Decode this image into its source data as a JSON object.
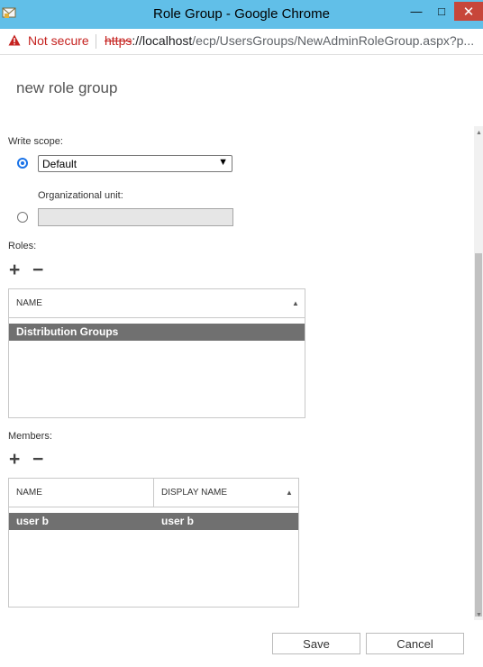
{
  "window": {
    "title": "Role Group - Google Chrome",
    "min_glyph": "—",
    "max_glyph": "□",
    "close_glyph": "✕"
  },
  "addressbar": {
    "not_secure": "Not secure",
    "scheme": "https",
    "host": "://localhost",
    "path": "/ecp/UsersGroups/NewAdminRoleGroup.aspx?p..."
  },
  "page": {
    "title": "new role group"
  },
  "write_scope": {
    "label": "Write scope:",
    "selected": "Default",
    "org_unit_label": "Organizational unit:",
    "org_unit_value": ""
  },
  "roles": {
    "label": "Roles:",
    "add_glyph": "+",
    "remove_glyph": "−",
    "columns": [
      "NAME"
    ],
    "rows": [
      [
        "Distribution Groups"
      ]
    ]
  },
  "members": {
    "label": "Members:",
    "add_glyph": "+",
    "remove_glyph": "−",
    "columns": [
      "NAME",
      "DISPLAY NAME"
    ],
    "rows": [
      [
        "user b",
        "user b"
      ]
    ]
  },
  "footer": {
    "save": "Save",
    "cancel": "Cancel"
  },
  "colors": {
    "titlebar": "#61bfe8",
    "selected_row": "#707070",
    "warning": "#c5221f",
    "radio": "#1a73e8"
  }
}
